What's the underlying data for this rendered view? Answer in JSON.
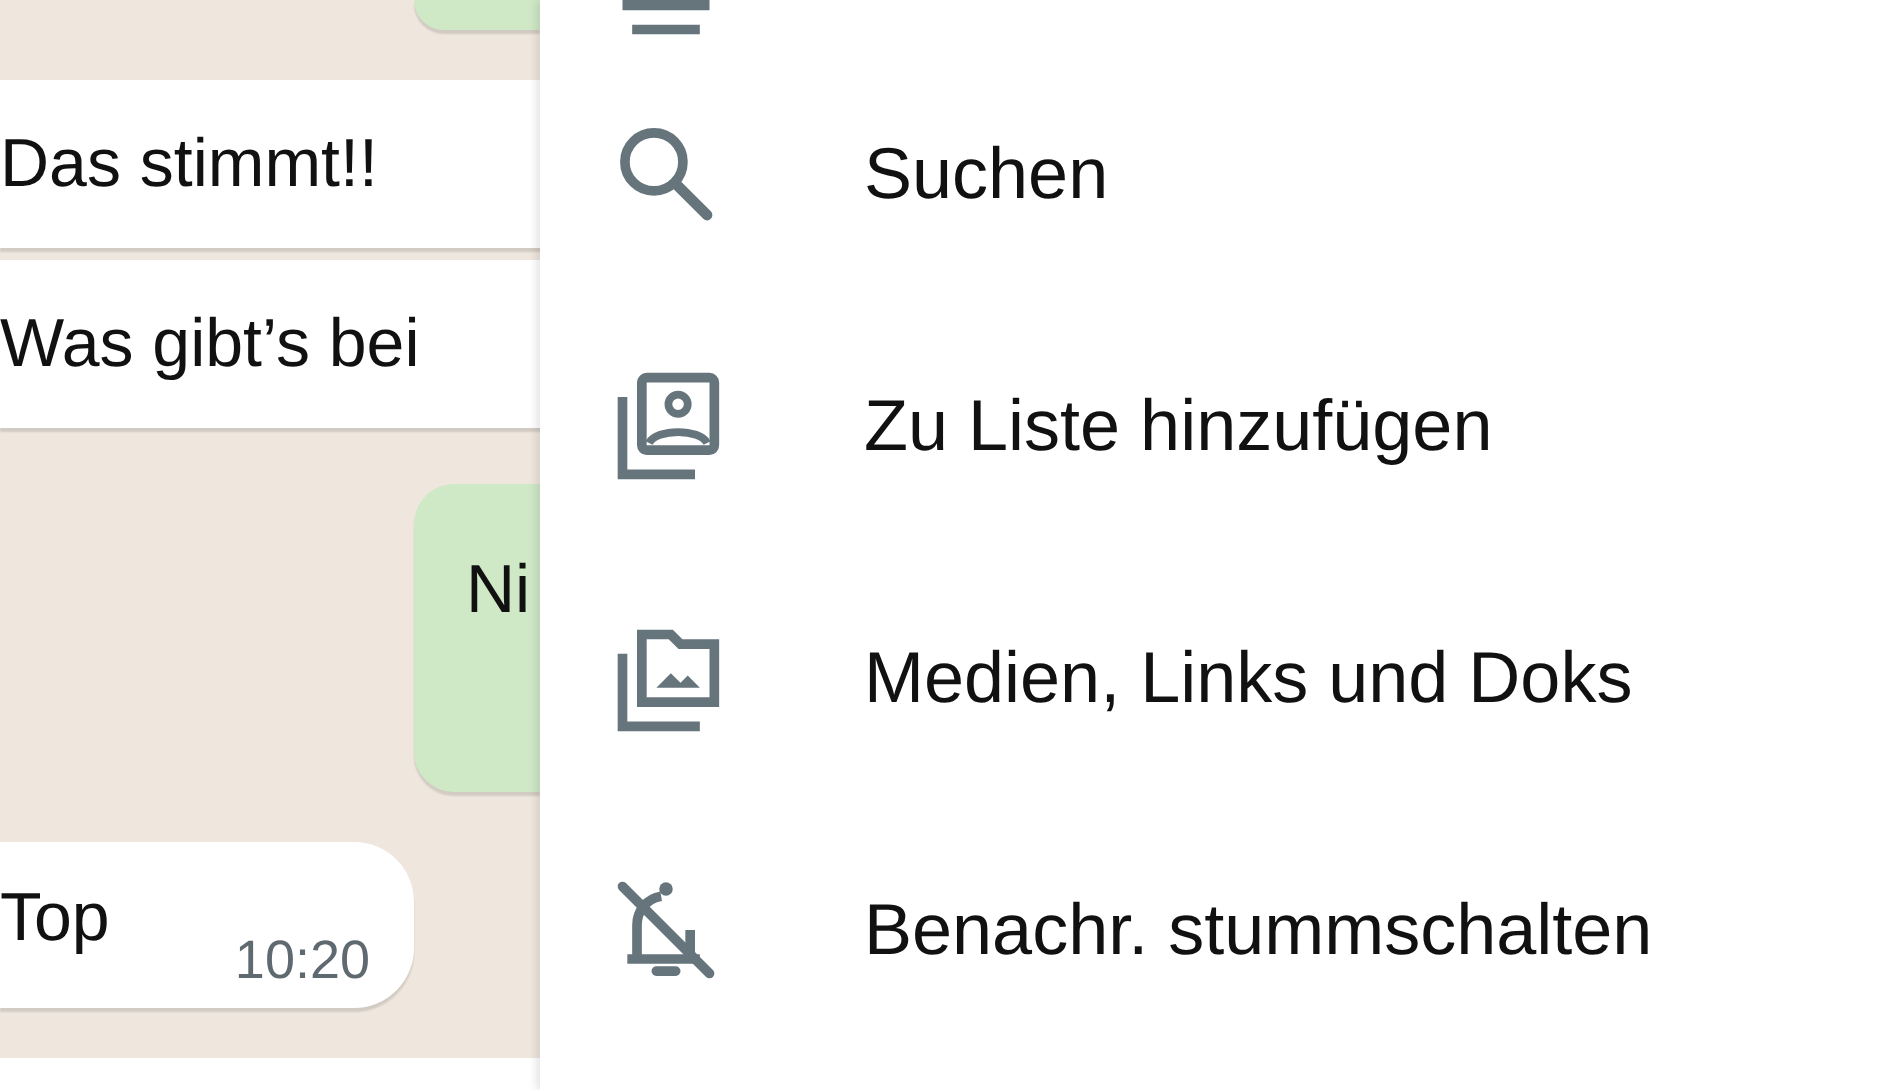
{
  "messages": [
    {
      "kind": "outgoing"
    },
    {
      "kind": "incoming",
      "text": "Das stimmt!!"
    },
    {
      "kind": "incoming",
      "text": "Was gibt’s bei"
    },
    {
      "kind": "outgoing",
      "text": "Ni"
    },
    {
      "kind": "incoming",
      "text": "Top",
      "time": "10:20"
    },
    {
      "kind": "incoming"
    }
  ],
  "menu": {
    "items": [
      {
        "kind": "contact"
      },
      {
        "kind": "search",
        "label": "Suchen"
      },
      {
        "kind": "list",
        "label": "Zu Liste hinzufügen"
      },
      {
        "kind": "media",
        "label": "Medien, Links und Doks"
      },
      {
        "kind": "mute",
        "label": "Benachr. stummschalten"
      }
    ]
  }
}
